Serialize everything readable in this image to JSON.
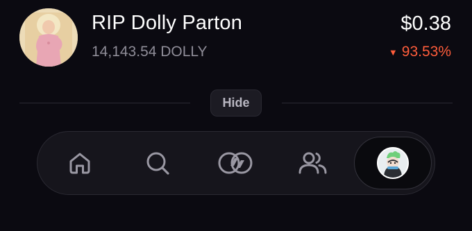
{
  "token": {
    "name": "RIP Dolly Parton",
    "amount": "14,143.54 DOLLY",
    "price": "$0.38",
    "change": "93.53%",
    "change_direction": "down",
    "change_color": "#ff5d3b",
    "avatar": "token-avatar-image"
  },
  "hide_button": {
    "label": "Hide"
  },
  "nav": {
    "items": [
      {
        "icon": "home-icon"
      },
      {
        "icon": "search-icon"
      },
      {
        "icon": "tokens-icon"
      },
      {
        "icon": "social-icon"
      },
      {
        "icon": "profile-avatar",
        "active": true
      }
    ]
  },
  "colors": {
    "background": "#0b0a11",
    "muted_text": "#8f8d98",
    "negative": "#ff5d3b"
  }
}
